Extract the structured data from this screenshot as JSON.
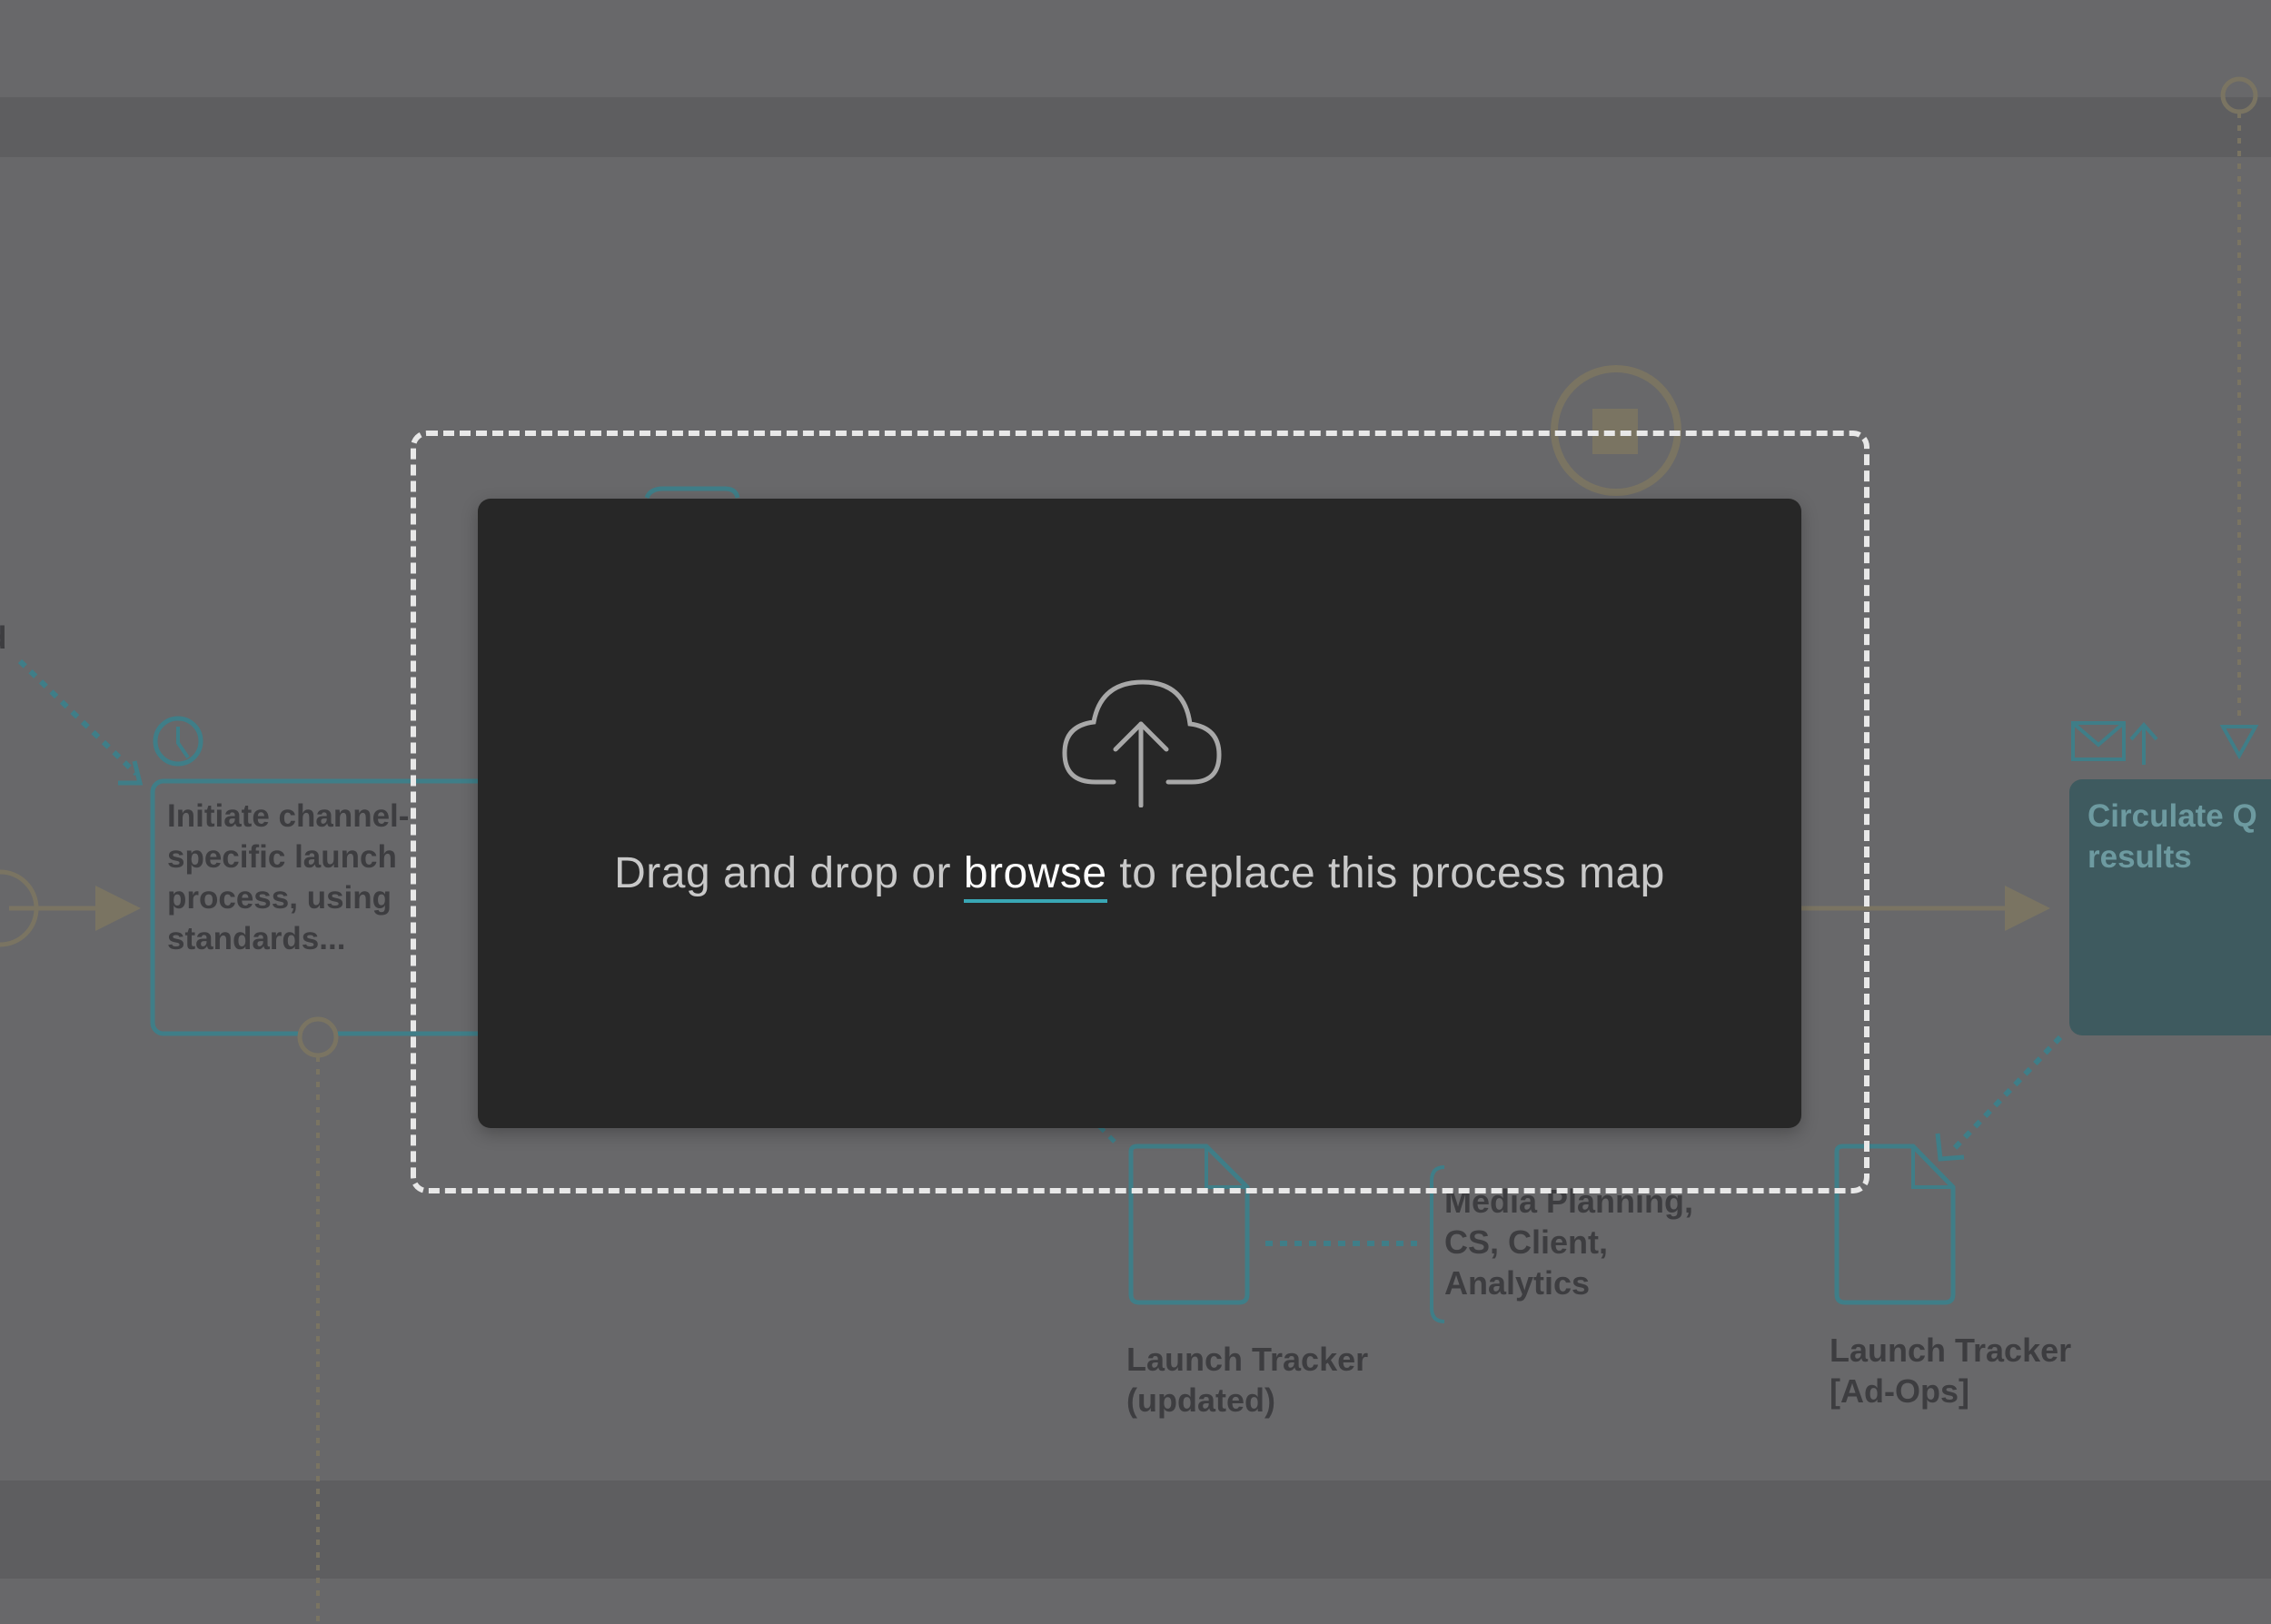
{
  "diagram": {
    "task_initiate": "Initiate channel-\nspecific launch\nprocess, using\nstandards...",
    "task_circulate": "Circulate Q\nresults",
    "participants": "Media Planning,\nCS, Client,\nAnalytics",
    "doc_launch_tracker_updated": "Launch Tracker\n(updated)",
    "doc_launch_tracker_adops": "Launch Tracker\n[Ad-Ops]",
    "partial_left_char": "d",
    "colors": {
      "teal": "#3f7e88",
      "olive": "#7a7462",
      "background": "#68686a"
    }
  },
  "upload_modal": {
    "icon": "cloud-upload-icon",
    "text_before": "Drag and drop or ",
    "browse_label": "browse",
    "text_after": " to replace this process map",
    "accent_color": "#39a7b5"
  }
}
